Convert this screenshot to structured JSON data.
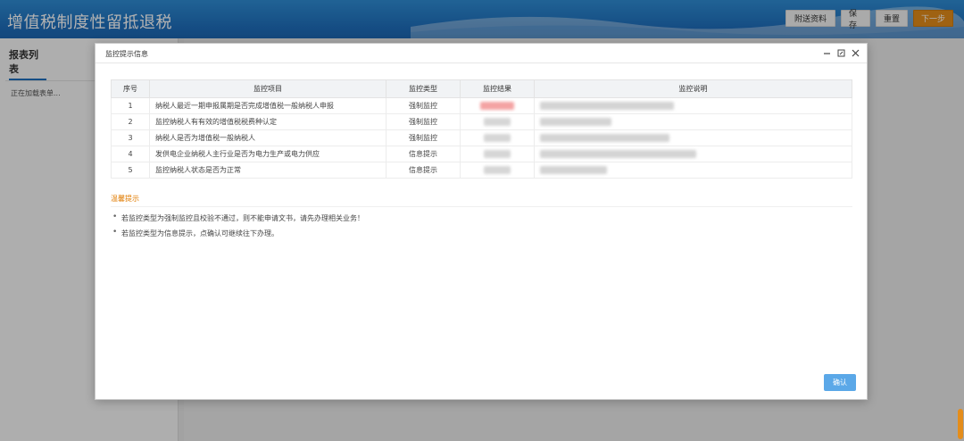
{
  "app": {
    "title": "增值税制度性留抵退税",
    "buttons": {
      "attachments": "附送资料",
      "save": "保存",
      "reset": "重置",
      "next": "下一步"
    },
    "colors": {
      "header": "#1f6fbd",
      "next": "#e48d1b",
      "confirm": "#5ba8e8",
      "tip": "#e07b00"
    }
  },
  "sidebar": {
    "title": "报表列表",
    "loading": "正在加载表单..."
  },
  "modal": {
    "title": "监控提示信息",
    "controls": {
      "minimize": "minimize-icon",
      "maximize": "maximize-icon",
      "close": "close-icon"
    },
    "columns": [
      "序号",
      "监控项目",
      "监控类型",
      "监控结果",
      "监控说明"
    ],
    "rows": [
      {
        "no": "1",
        "item": "纳税人最近一期申报属期是否完成增值税一般纳税人申报",
        "type": "强制监控"
      },
      {
        "no": "2",
        "item": "监控纳税人有有效的增值税税费种认定",
        "type": "强制监控"
      },
      {
        "no": "3",
        "item": "纳税人是否为增值税一般纳税人",
        "type": "强制监控"
      },
      {
        "no": "4",
        "item": "发供电企业纳税人主行业是否为电力生产或电力供应",
        "type": "信息提示"
      },
      {
        "no": "5",
        "item": "监控纳税人状态是否为正常",
        "type": "信息提示"
      }
    ],
    "tips_title": "温馨提示",
    "tips": [
      "若监控类型为强制监控且校验不通过，则不能申请文书，请先办理相关业务！",
      "若监控类型为信息提示，点确认可继续往下办理。"
    ],
    "confirm_label": "确认"
  }
}
